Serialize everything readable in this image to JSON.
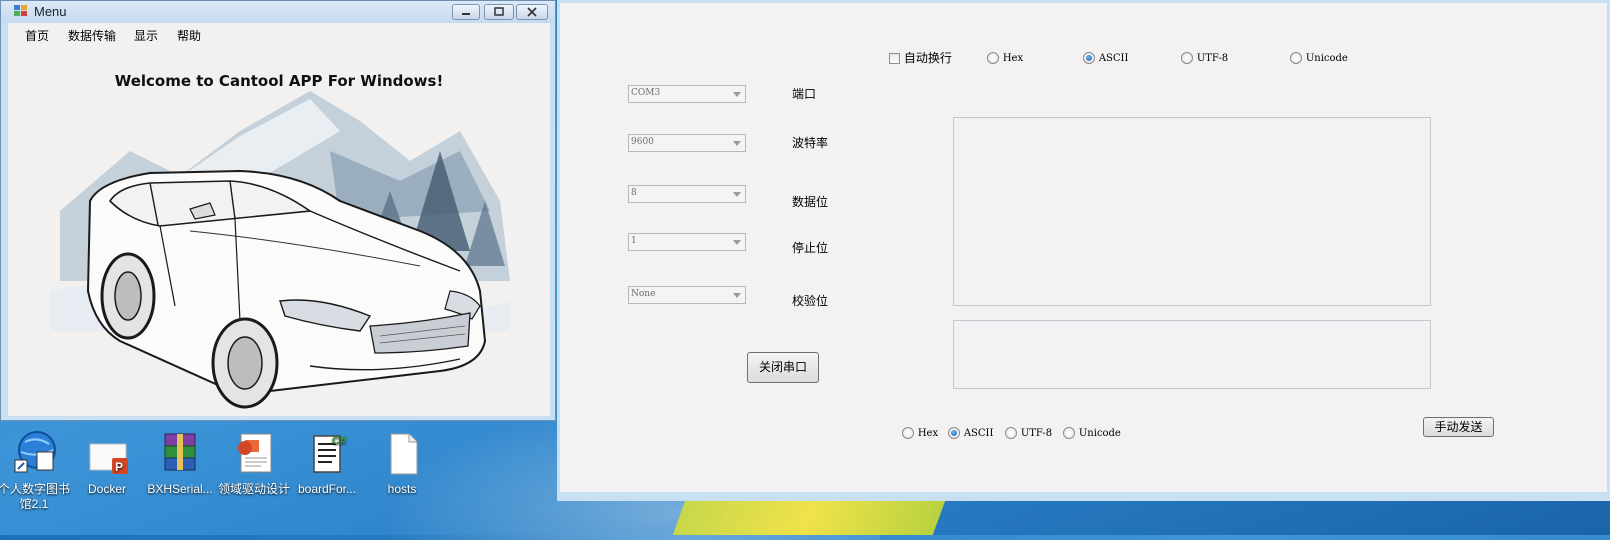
{
  "menu_window": {
    "title": "Menu",
    "menu_bar": [
      "首页",
      "数据传输",
      "显示",
      "帮助"
    ],
    "welcome_text": "Welcome to Cantool APP For Windows!"
  },
  "desktop": {
    "icons": [
      {
        "label1": "个人数字图书",
        "label2": "馆2.1",
        "icon": "globe-shortcut-icon"
      },
      {
        "label1": "Docker",
        "label2": "",
        "icon": "powerpoint-file-icon"
      },
      {
        "label1": "BXHSerial...",
        "label2": "",
        "icon": "winrar-archive-icon"
      },
      {
        "label1": "领域驱动设计",
        "label2": "",
        "icon": "powerpoint-document-icon"
      },
      {
        "label1": "boardFor...",
        "label2": "",
        "icon": "csharp-file-icon"
      },
      {
        "label1": "hosts",
        "label2": "",
        "icon": "blank-file-icon"
      }
    ]
  },
  "serial": {
    "auto_newline": {
      "label": "自动换行",
      "checked": false
    },
    "receive_encoding": {
      "options": [
        "Hex",
        "ASCII",
        "UTF-8",
        "Unicode"
      ],
      "selected": "ASCII"
    },
    "port": {
      "value": "COM3",
      "label": "端口"
    },
    "baud": {
      "value": "9600",
      "label": "波特率"
    },
    "databits": {
      "value": "8",
      "label": "数据位"
    },
    "stopbits": {
      "value": "1",
      "label": "停止位"
    },
    "parity": {
      "value": "None",
      "label": "校验位"
    },
    "close_button": "关闭串口",
    "send_encoding": {
      "options": [
        "Hex",
        "ASCII",
        "UTF-8",
        "Unicode"
      ],
      "selected": "ASCII"
    },
    "send_button": "手动发送"
  }
}
